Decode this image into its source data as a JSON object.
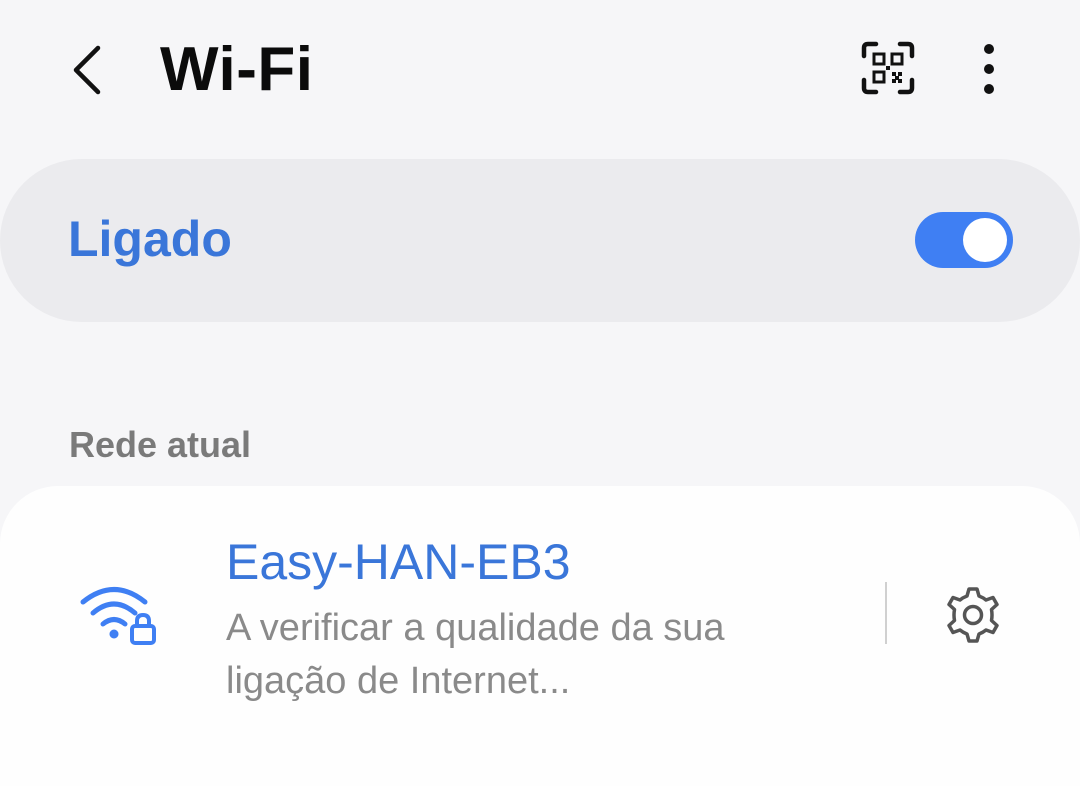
{
  "header": {
    "title": "Wi-Fi",
    "back_icon": "chevron-left-icon",
    "qr_icon": "qr-code-scan-icon",
    "more_icon": "more-vertical-icon"
  },
  "wifi_toggle": {
    "label": "Ligado",
    "state": "on",
    "accent_color": "#3f7ff3"
  },
  "current_network": {
    "section_title": "Rede atual",
    "name": "Easy-HAN-EB3",
    "status": "A verificar a qualidade da sua ligação de Internet...",
    "icon": "wifi-locked-icon",
    "settings_icon": "gear-icon"
  },
  "colors": {
    "accent_text": "#3a76d9",
    "background": "#f6f6f8"
  }
}
